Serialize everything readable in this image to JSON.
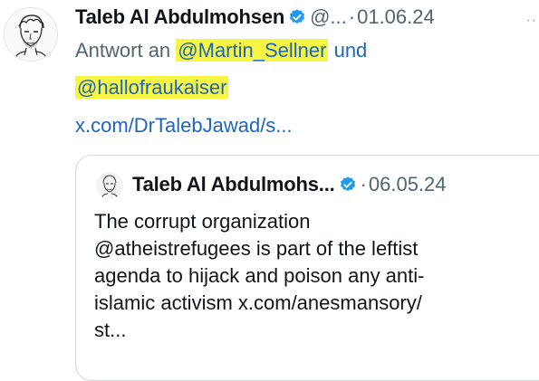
{
  "tweet": {
    "author_name": "Taleb Al Abdulmohsen",
    "handle": "@...",
    "separator": "·",
    "date": "01.06.24",
    "more": "··",
    "reply_prefix": "Antwort an ",
    "reply_mention_1": "@Martin_Sellner",
    "reply_and": " und",
    "reply_mention_2": "@hallofraukaiser",
    "link": "x.com/DrTalebJawad/s...",
    "verified_icon": "verified-badge-icon",
    "accent": "#1d65c0",
    "highlight": "#f6f542"
  },
  "quote": {
    "author_name": "Taleb Al Abdulmohs...",
    "separator": "·",
    "date": "06.05.24",
    "lines": [
      "The corrupt organization",
      "@atheistrefugees is part of the leftist",
      "agenda to hijack and poison any anti-",
      "islamic activism x.com/anesmansory/",
      "st..."
    ]
  }
}
